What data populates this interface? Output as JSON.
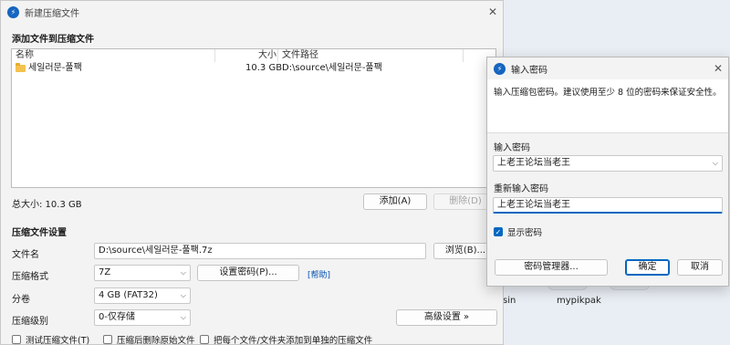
{
  "main_window": {
    "title": "新建压缩文件",
    "close_glyph": "✕",
    "add_section": {
      "heading": "添加文件到压缩文件",
      "columns": {
        "name": "名称",
        "size": "大小",
        "path": "文件路径"
      },
      "rows": [
        {
          "name": "세일러문-풀팩",
          "size": "10.3 GB",
          "path": "D:\\source\\세일러문-풀팩"
        }
      ],
      "total_size": "总大小: 10.3 GB",
      "add_button": "添加(A)",
      "delete_button": "删除(D)"
    },
    "settings": {
      "heading": "压缩文件设置",
      "filename_label": "文件名",
      "filename_value": "D:\\source\\세일러문-풀팩.7z",
      "browse_button": "浏览(B)...",
      "format_label": "压缩格式",
      "format_value": "7Z",
      "set_password_button": "设置密码(P)...",
      "help_link": "[帮助]",
      "volume_label": "分卷",
      "volume_value": "4 GB (FAT32)",
      "level_label": "压缩级别",
      "level_value": "0-仅存储",
      "advanced_button": "高级设置 »"
    },
    "options": [
      {
        "label": "测试压缩文件(T)",
        "checked": false
      },
      {
        "label": "压缩后删除原始文件",
        "checked": false
      },
      {
        "label": "把每个文件/文件夹添加到单独的压缩文件",
        "checked": false
      }
    ]
  },
  "password_dialog": {
    "title": "输入密码",
    "close_glyph": "✕",
    "description": "输入压缩包密码。建议使用至少 8 位的密码来保证安全性。",
    "password_label": "输入密码",
    "password_value": "上老王论坛当老王",
    "confirm_label": "重新输入密码",
    "confirm_value": "上老王论坛当老王",
    "show_password_label": "显示密码",
    "show_password_checked": true,
    "manager_button": "密码管理器...",
    "ok_button": "确定",
    "cancel_button": "取消"
  },
  "desktop": {
    "items": [
      "sin",
      "mypikpak"
    ]
  },
  "icons": {
    "app": "app-logo-icon",
    "folder": "folder-icon",
    "chevron": "chevron-down-icon"
  },
  "colors": {
    "accent": "#0067c0",
    "link": "#0050b3",
    "folder": "#f4c24f"
  }
}
